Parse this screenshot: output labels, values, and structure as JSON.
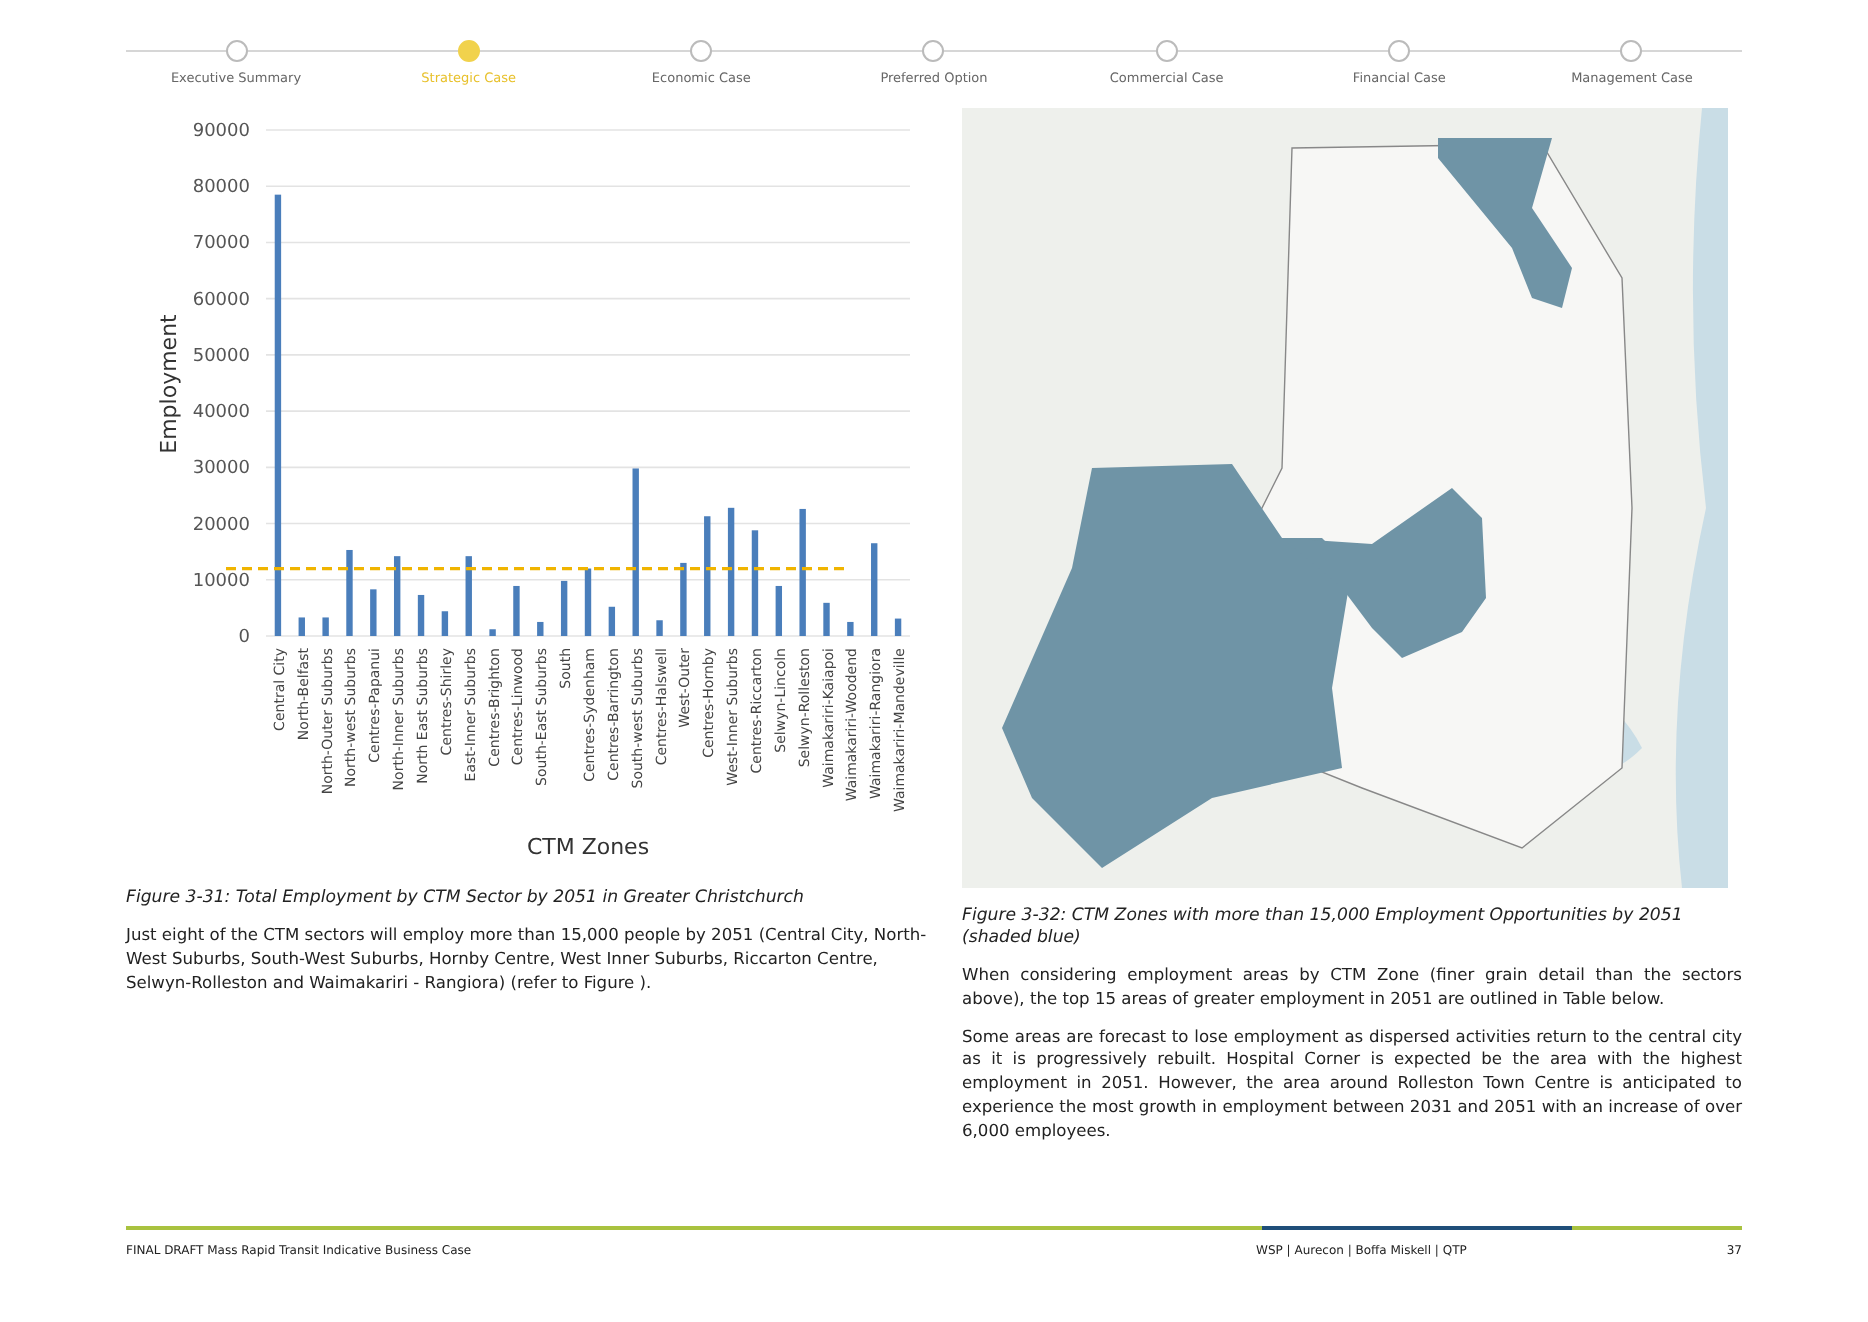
{
  "stepper": [
    {
      "label": "Executive Summary",
      "selected": false
    },
    {
      "label": "Strategic Case",
      "selected": true
    },
    {
      "label": "Economic Case",
      "selected": false
    },
    {
      "label": "Preferred Option",
      "selected": false
    },
    {
      "label": "Commercial Case",
      "selected": false
    },
    {
      "label": "Financial Case",
      "selected": false
    },
    {
      "label": "Management Case",
      "selected": false
    }
  ],
  "left": {
    "chart_data": {
      "type": "bar",
      "xlabel": "CTM Zones",
      "ylabel": "Employment",
      "categories": [
        "Central City",
        "North-Belfast",
        "North-Outer Suburbs",
        "North-west Suburbs",
        "Centres-Papanui",
        "North-Inner Suburbs",
        "North East Suburbs",
        "Centres-Shirley",
        "East-Inner Suburbs",
        "Centres-Brighton",
        "Centres-Linwood",
        "South-East Suburbs",
        "South",
        "Centres-Sydenham",
        "Centres-Barrington",
        "South-west Suburbs",
        "Centres-Halswell",
        "West-Outer",
        "Centres-Hornby",
        "West-Inner Suburbs",
        "Centres-Riccarton",
        "Selwyn-Lincoln",
        "Selwyn-Rolleston",
        "Waimakariri-Kaiapoi",
        "Waimakariri-Woodend",
        "Waimakariri-Rangiora",
        "Waimakariri-Mandeville"
      ],
      "series": [
        {
          "color": "#4a7ebb",
          "values": [
            78500,
            3300,
            3300,
            15300,
            8300,
            14200,
            7300,
            4400,
            14200,
            1200,
            8900,
            2500,
            9800,
            12000,
            5200,
            29800,
            2800,
            13000,
            21300,
            22800,
            18800,
            8900,
            22600,
            5900,
            2500,
            16500,
            3100
          ]
        }
      ],
      "ylim": [
        0,
        90000
      ],
      "yticks": [
        0,
        10000,
        20000,
        30000,
        40000,
        50000,
        60000,
        70000,
        80000,
        90000
      ],
      "grid": true,
      "ref_lines": [
        {
          "axis": "y",
          "value": 12000,
          "color": "#f0b400"
        }
      ]
    },
    "caption": "Figure 3-31: Total Employment by CTM Sector by 2051 in Greater Christchurch",
    "paragraphs": [
      "Just eight of the CTM sectors will employ more than 15,000 people by 2051 (Central City, North-West Suburbs, South-West Suburbs, Hornby Centre, West Inner Suburbs, Riccarton Centre, Selwyn-Rolleston and Waimakariri - Rangiora) (refer to Figure )."
    ]
  },
  "right": {
    "caption": "Figure 3-32: CTM Zones with more than 15,000 Employment Opportunities by 2051 (shaded blue)",
    "paragraphs": [
      "When considering employment areas by CTM Zone (finer grain detail than the sectors above), the  top 15 areas of greater employment in 2051 are  outlined in Table  below.",
      "Some areas  are  forecast  to  lose employment as dispersed activities return to the central city as it is progressively rebuilt. Hospital Corner is expected be the area with the highest employment in 2051. However, the area around Rolleston Town Centre is anticipated to experience the most growth in employment between 2031 and 2051 with an increase of over 6,000 employees."
    ]
  },
  "footer": {
    "title": "FINAL DRAFT Mass Rapid Transit Indicative Business Case",
    "partners": "WSP | Aurecon | Boffa Miskell | QTP",
    "page": "37"
  }
}
